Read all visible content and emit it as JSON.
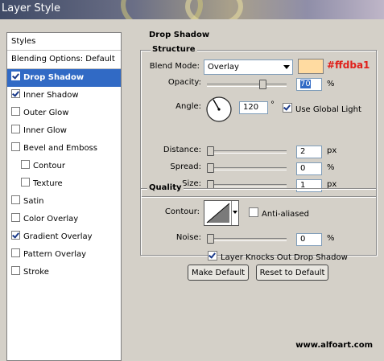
{
  "window": {
    "title": "Layer Style"
  },
  "sidebar": {
    "header": "Styles",
    "blending_options": "Blending Options: Default",
    "items": [
      {
        "label": "Drop Shadow",
        "checked": true,
        "selected": true
      },
      {
        "label": "Inner Shadow",
        "checked": true
      },
      {
        "label": "Outer Glow",
        "checked": false
      },
      {
        "label": "Inner Glow",
        "checked": false
      },
      {
        "label": "Bevel and Emboss",
        "checked": false
      },
      {
        "label": "Contour",
        "checked": false,
        "sub": true
      },
      {
        "label": "Texture",
        "checked": false,
        "sub": true
      },
      {
        "label": "Satin",
        "checked": false
      },
      {
        "label": "Color Overlay",
        "checked": false
      },
      {
        "label": "Gradient Overlay",
        "checked": true
      },
      {
        "label": "Pattern Overlay",
        "checked": false
      },
      {
        "label": "Stroke",
        "checked": false
      }
    ]
  },
  "panel": {
    "title": "Drop Shadow",
    "structure": {
      "title": "Structure",
      "blend_mode_label": "Blend Mode:",
      "blend_mode_value": "Overlay",
      "color_swatch": "#ffdba1",
      "color_annotation": "#ffdba1",
      "opacity_label": "Opacity:",
      "opacity_value": "70",
      "opacity_unit": "%",
      "opacity_level": 0.7,
      "angle_label": "Angle:",
      "angle_value": "120",
      "angle_unit": "°",
      "use_global_light_label": "Use Global Light",
      "use_global_light_checked": true,
      "distance_label": "Distance:",
      "distance_value": "2",
      "distance_unit": "px",
      "spread_label": "Spread:",
      "spread_value": "0",
      "spread_unit": "%",
      "size_label": "Size:",
      "size_value": "1",
      "size_unit": "px"
    },
    "quality": {
      "title": "Quality",
      "contour_label": "Contour:",
      "anti_aliased_label": "Anti-aliased",
      "anti_aliased_checked": false,
      "noise_label": "Noise:",
      "noise_value": "0",
      "noise_unit": "%"
    },
    "knockout_label": "Layer Knocks Out Drop Shadow",
    "knockout_checked": true,
    "make_default_label": "Make Default",
    "reset_default_label": "Reset to Default"
  },
  "watermark": "www.alfoart.com",
  "colors": {
    "selection": "#316ac5",
    "annotation_red": "#e0201a"
  }
}
